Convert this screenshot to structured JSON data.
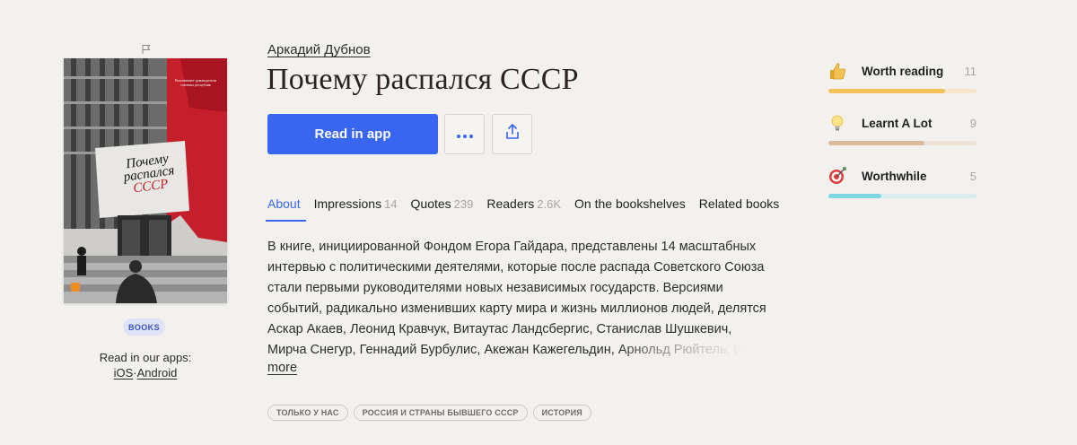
{
  "book": {
    "author": "Аркадий Дубнов",
    "title": "Почему распался СССР",
    "cover": {
      "title_line1": "Почему",
      "title_line2": "распался",
      "title_line3": "СССР",
      "blurb": "Вспоминают руководители союзных республик",
      "accent_color": "#c41f2b"
    },
    "category_badge": "BOOKS"
  },
  "apps": {
    "label": "Read in our apps:",
    "ios": "iOS",
    "separator": "·",
    "android": "Android"
  },
  "actions": {
    "read_label": "Read in app",
    "more_icon": "ellipsis-icon",
    "share_icon": "share-icon",
    "accent_color": "#3866f0"
  },
  "tabs": [
    {
      "label": "About",
      "count": "",
      "active": true
    },
    {
      "label": "Impressions",
      "count": "14"
    },
    {
      "label": "Quotes",
      "count": "239"
    },
    {
      "label": "Readers",
      "count": "2.6K"
    },
    {
      "label": "On the bookshelves",
      "count": ""
    },
    {
      "label": "Related books",
      "count": ""
    }
  ],
  "description": {
    "lines": [
      "В книге, инициированной Фондом Егора Гайдара, представлены 14 масштабных",
      "интервью с политическими деятелями, которые после распада Советского Союза",
      "стали первыми руководителями новых независимых государств. Версиями",
      "событий, радикально изменивших карту мира и жизнь миллионов людей, делятся",
      "Аскар Акаев, Леонид Кравчук, Витаутас Ландсбергис, Станислав Шушкевич,"
    ],
    "last_line_visible": "Мирча Снегур, Геннадий Бурбулис, Акежан Кажегельдин, ",
    "last_line_faded": "Арнольд Рюйтель, И",
    "more_label": "more"
  },
  "tags": [
    "ТОЛЬКО У НАС",
    "РОССИЯ И СТРАНЫ БЫВШЕГО СССР",
    "ИСТОРИЯ"
  ],
  "reactions": [
    {
      "label": "Worth reading",
      "count": "11",
      "icon": "thumbs-up-icon",
      "fraction": 0.79,
      "color": "#f5c25a"
    },
    {
      "label": "Learnt A Lot",
      "count": "9",
      "icon": "lightbulb-icon",
      "fraction": 0.65,
      "color": "#d9bb9a"
    },
    {
      "label": "Worthwhile",
      "count": "5",
      "icon": "target-icon",
      "fraction": 0.36,
      "color": "#7fd6e3"
    }
  ]
}
